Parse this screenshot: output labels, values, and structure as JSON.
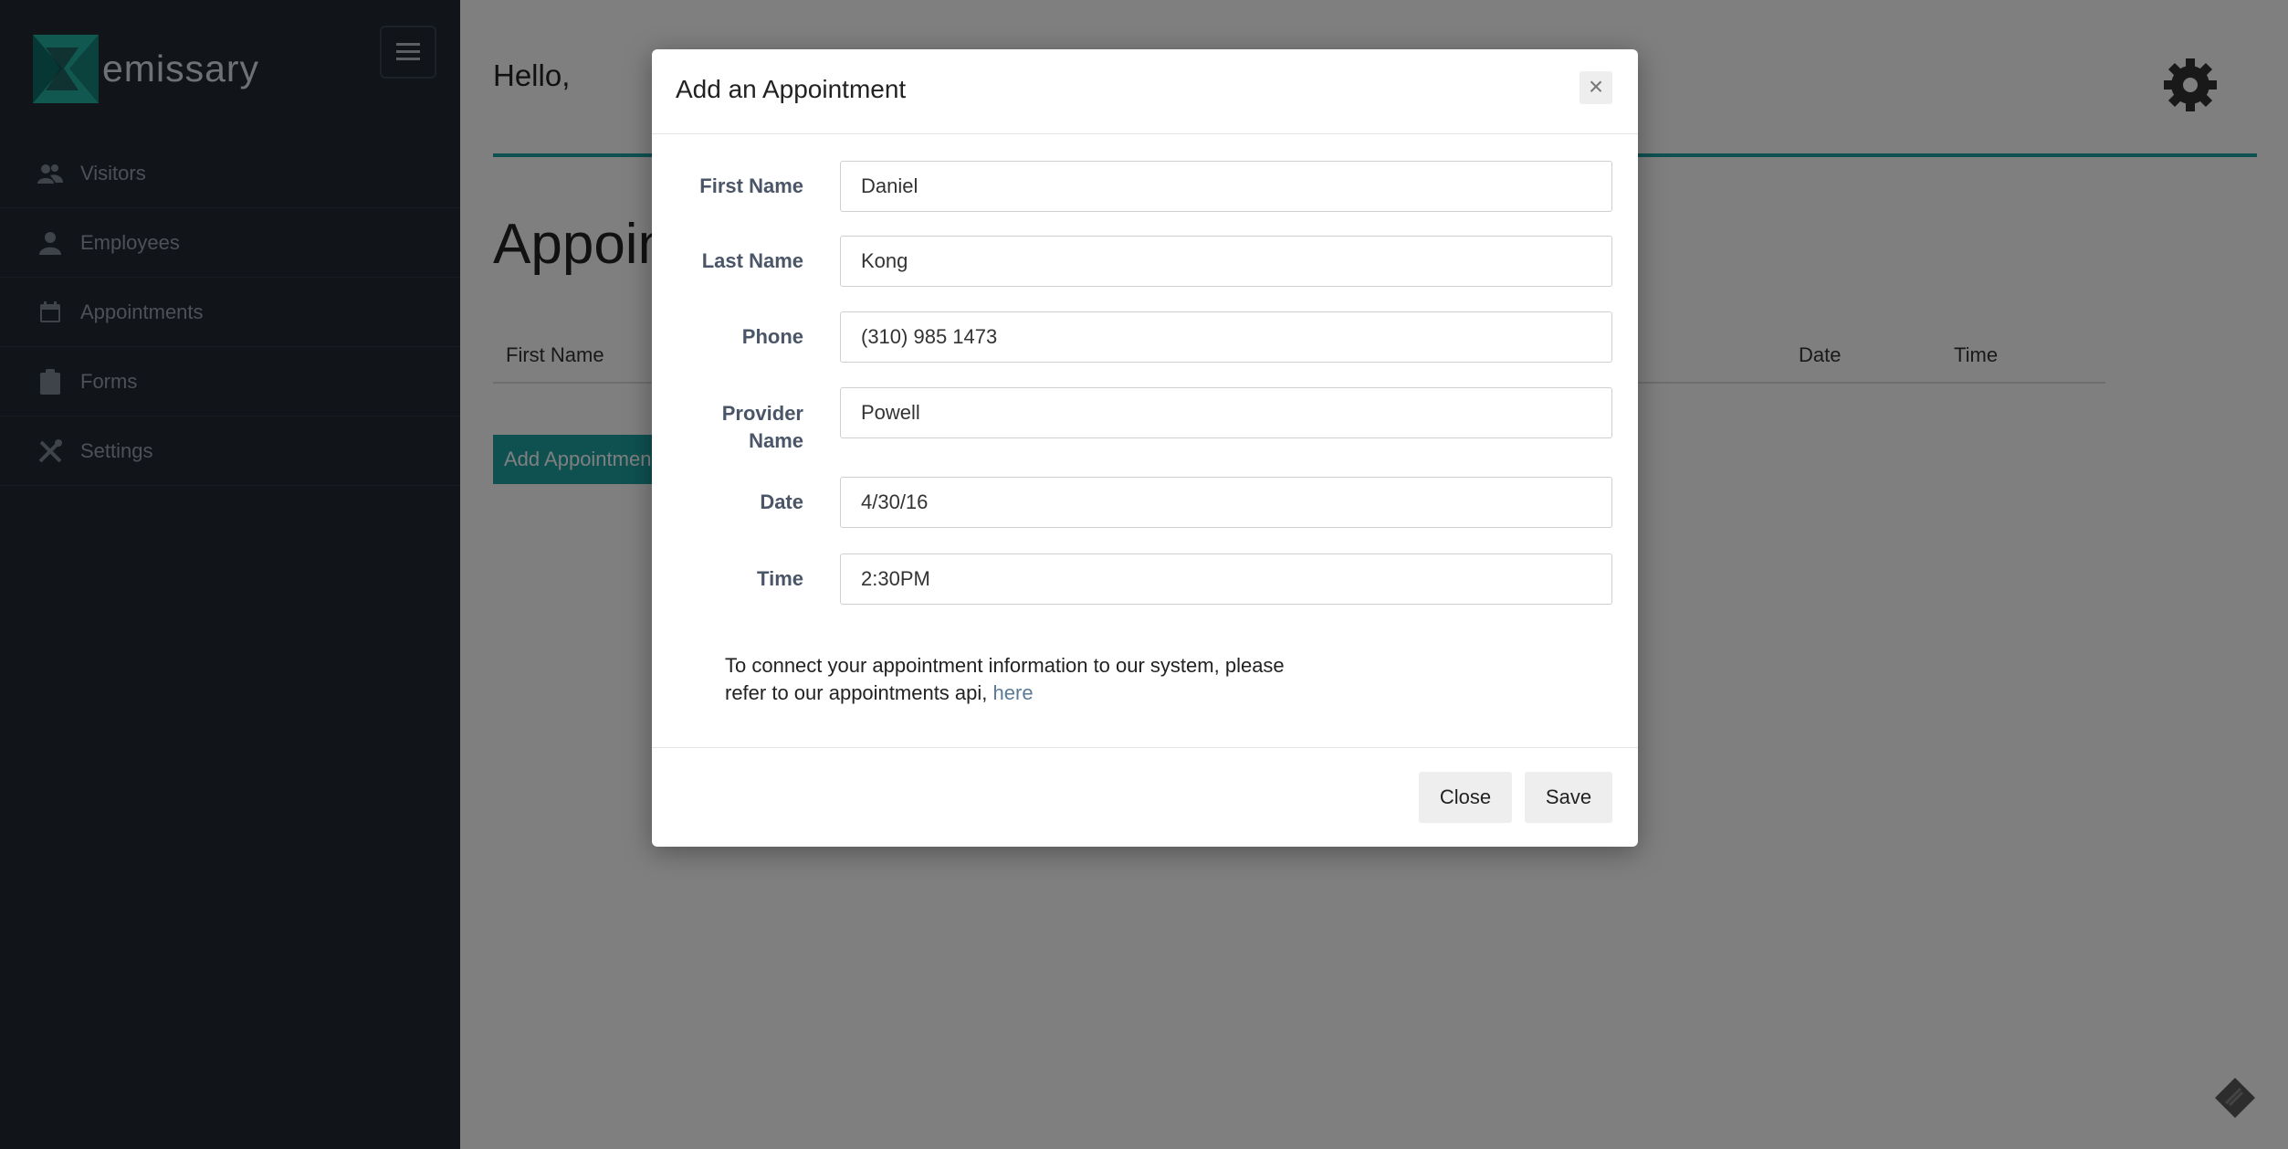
{
  "brand": {
    "name": "emissary",
    "accent_color": "#1fa2a2"
  },
  "sidebar": {
    "items": [
      {
        "label": "Visitors",
        "icon": "users-icon"
      },
      {
        "label": "Employees",
        "icon": "user-icon"
      },
      {
        "label": "Appointments",
        "icon": "calendar-icon"
      },
      {
        "label": "Forms",
        "icon": "clipboard-icon"
      },
      {
        "label": "Settings",
        "icon": "tools-icon"
      }
    ]
  },
  "header": {
    "greeting": "Hello,"
  },
  "page": {
    "title": "Appointments",
    "table_headers": [
      "First Name",
      "Date",
      "Time"
    ],
    "add_button_label": "Add Appointment"
  },
  "modal": {
    "title": "Add an Appointment",
    "close_symbol": "×",
    "fields": [
      {
        "label": "First Name",
        "value": "Daniel"
      },
      {
        "label": "Last Name",
        "value": "Kong"
      },
      {
        "label": "Phone",
        "value": "(310) 985 1473"
      },
      {
        "label_line1": "Provider",
        "label_line2": "Name",
        "value": "Powell"
      },
      {
        "label": "Date",
        "value": "4/30/16"
      },
      {
        "label": "Time",
        "value": "2:30PM"
      }
    ],
    "note_line1": "To connect your appointment information to our system, please",
    "note_line2": "refer to our appointments api,",
    "note_link": "here",
    "close_label": "Close",
    "save_label": "Save"
  }
}
